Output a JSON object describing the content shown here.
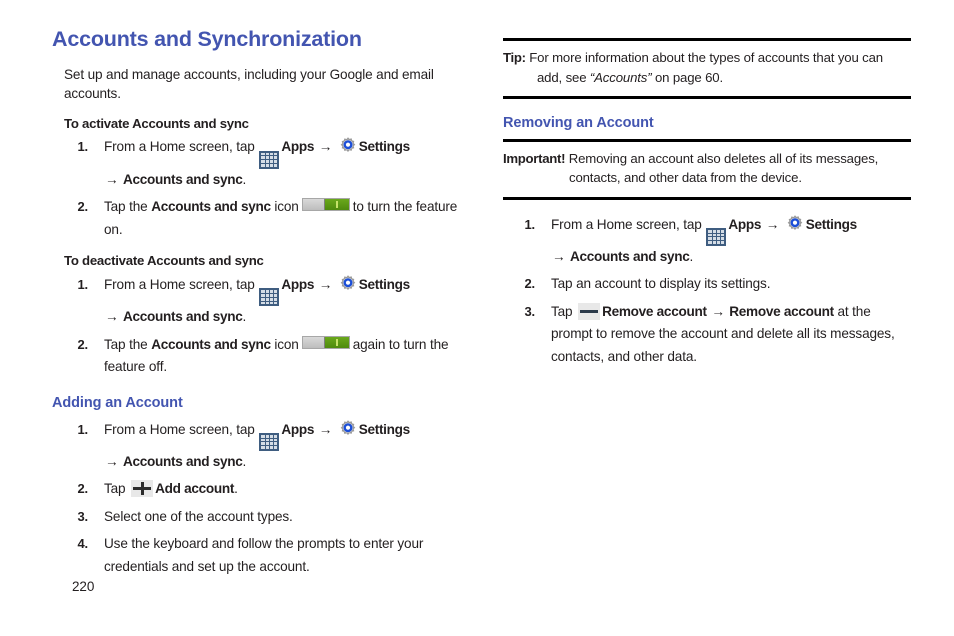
{
  "document": {
    "page_number": "220"
  },
  "left_column": {
    "chapter_title": "Accounts and Synchronization",
    "intro": "Set up and manage accounts, including your Google and email accounts.",
    "procedures": [
      {
        "heading": "To activate Accounts and sync",
        "steps": [
          {
            "number": "1.",
            "text_1": "From a Home screen, tap",
            "icon_1": "apps-grid-icon",
            "bold_1": "Apps",
            "arrow_1": "→",
            "icon_2": "settings-gear-icon",
            "bold_2": "Settings",
            "arrow_2": "→",
            "bold_3": "Accounts and sync",
            "text_end": "."
          },
          {
            "number": "2.",
            "text_1": "Tap the",
            "bold_1": "Accounts and sync",
            "text_2": "icon",
            "icon_1": "toggle-switch-on-icon",
            "text_3": "to turn the feature on."
          }
        ]
      },
      {
        "heading": "To deactivate Accounts and sync",
        "steps": [
          {
            "number": "1.",
            "text_1": "From a Home screen, tap",
            "icon_1": "apps-grid-icon",
            "bold_1": "Apps",
            "arrow_1": "→",
            "icon_2": "settings-gear-icon",
            "bold_2": "Settings",
            "arrow_2": "→",
            "bold_3": "Accounts and sync",
            "text_end": "."
          },
          {
            "number": "2.",
            "text_1": "Tap the",
            "bold_1": "Accounts and sync",
            "text_2": "icon",
            "icon_1": "toggle-switch-on-icon",
            "text_3": "again to turn the feature off."
          }
        ]
      }
    ],
    "adding_section": {
      "heading": "Adding an Account",
      "steps": [
        {
          "number": "1.",
          "text_1": "From a Home screen, tap",
          "icon_1": "apps-grid-icon",
          "bold_1": "Apps",
          "arrow_1": "→",
          "icon_2": "settings-gear-icon",
          "bold_2": "Settings",
          "arrow_2": "→",
          "bold_3": "Accounts and sync",
          "text_end": "."
        },
        {
          "number": "2.",
          "text_1": "Tap",
          "icon_1": "plus-add-icon",
          "bold_1": "Add account",
          "text_end": "."
        },
        {
          "number": "3.",
          "text_1": "Select one of the account types."
        },
        {
          "number": "4.",
          "text_1": "Use the keyboard and follow the prompts to enter your credentials and set up the account."
        }
      ]
    }
  },
  "right_column": {
    "tip": {
      "label": "Tip:",
      "text_1": "For more information about the types of accounts that you can add, see",
      "italic_ref": "“Accounts”",
      "text_2": "on page 60."
    },
    "removing_section": {
      "heading": "Removing an Account",
      "important": {
        "label": "Important!",
        "text": "Removing an account also deletes all of its messages, contacts, and other data from the device."
      },
      "steps": [
        {
          "number": "1.",
          "text_1": "From a Home screen, tap",
          "icon_1": "apps-grid-icon",
          "bold_1": "Apps",
          "arrow_1": "→",
          "icon_2": "settings-gear-icon",
          "bold_2": "Settings",
          "arrow_2": "→",
          "bold_3": "Accounts and sync",
          "text_end": "."
        },
        {
          "number": "2.",
          "text_1": "Tap an account to display its settings."
        },
        {
          "number": "3.",
          "text_1": "Tap",
          "icon_1": "minus-remove-icon",
          "bold_1": "Remove account",
          "arrow_1": "→",
          "bold_2": "Remove account",
          "text_2": "at the prompt to remove the account and delete all its messages, contacts, and other data."
        }
      ]
    }
  },
  "colors": {
    "heading_blue": "#4355b0",
    "body_text": "#231f20",
    "apps_icon_bg": "#3f5d80",
    "toggle_green": "#5e9a15",
    "toggle_gray": "#cccccc"
  }
}
